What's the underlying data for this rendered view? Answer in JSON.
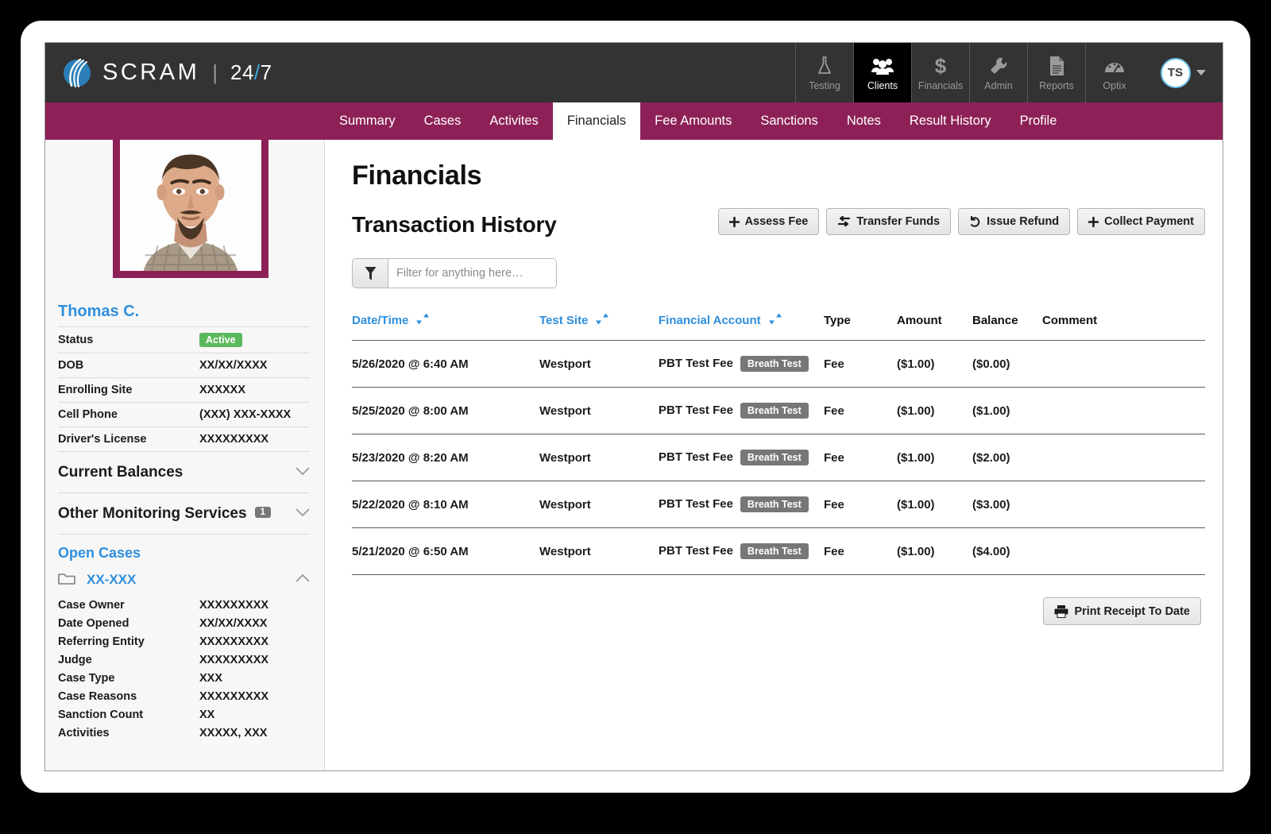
{
  "brand": {
    "name": "SCRAM",
    "separator": "|",
    "suffix_left": "24",
    "slash": "/",
    "suffix_right": "7",
    "logo_icon": "scram-wave-logo-icon"
  },
  "topnav": {
    "items": [
      {
        "label": "Testing",
        "icon": "flask-icon",
        "active": false
      },
      {
        "label": "Clients",
        "icon": "people-icon",
        "active": true
      },
      {
        "label": "Financials",
        "icon": "dollar-sign-icon",
        "active": false
      },
      {
        "label": "Admin",
        "icon": "wrench-icon",
        "active": false
      },
      {
        "label": "Reports",
        "icon": "document-icon",
        "active": false
      },
      {
        "label": "Optix",
        "icon": "gauge-icon",
        "active": false
      }
    ],
    "avatar_initials": "TS",
    "avatar_caret_icon": "caret-down-icon"
  },
  "tabs": [
    {
      "label": "Summary",
      "active": false
    },
    {
      "label": "Cases",
      "active": false
    },
    {
      "label": "Activites",
      "active": false
    },
    {
      "label": "Financials",
      "active": true
    },
    {
      "label": "Fee Amounts",
      "active": false
    },
    {
      "label": "Sanctions",
      "active": false
    },
    {
      "label": "Notes",
      "active": false
    },
    {
      "label": "Result History",
      "active": false
    },
    {
      "label": "Profile",
      "active": false
    }
  ],
  "sidebar": {
    "photo_alt": "client-photo",
    "client_name": "Thomas C.",
    "details": [
      {
        "key": "Status",
        "value": "Active",
        "is_badge": true
      },
      {
        "key": "DOB",
        "value": "XX/XX/XXXX",
        "is_badge": false
      },
      {
        "key": "Enrolling Site",
        "value": "XXXXXX",
        "is_badge": false
      },
      {
        "key": "Cell Phone",
        "value": "(XXX) XXX-XXXX",
        "is_badge": false
      },
      {
        "key": "Driver's License",
        "value": "XXXXXXXXX",
        "is_badge": false
      }
    ],
    "accordions": [
      {
        "title": "Current Balances",
        "count": null,
        "chevron": "chevron-down-icon"
      },
      {
        "title": "Other Monitoring Services",
        "count": "1",
        "chevron": "chevron-down-icon"
      }
    ],
    "open_cases_title": "Open Cases",
    "case": {
      "folder_icon": "folder-icon",
      "id": "XX-XXX",
      "chevron": "chevron-up-icon",
      "fields": [
        {
          "key": "Case Owner",
          "value": "XXXXXXXXX"
        },
        {
          "key": "Date Opened",
          "value": "XX/XX/XXXX"
        },
        {
          "key": "Referring Entity",
          "value": "XXXXXXXXX"
        },
        {
          "key": "Judge",
          "value": "XXXXXXXXX"
        },
        {
          "key": "Case Type",
          "value": "XXX"
        },
        {
          "key": "Case Reasons",
          "value": "XXXXXXXXX"
        },
        {
          "key": "Sanction Count",
          "value": "XX"
        },
        {
          "key": "Activities",
          "value": "XXXXX, XXX"
        }
      ]
    }
  },
  "main": {
    "page_title": "Financials",
    "section_title": "Transaction History",
    "actions": [
      {
        "label": "Assess Fee",
        "icon": "plus-icon"
      },
      {
        "label": "Transfer Funds",
        "icon": "transfer-arrows-icon"
      },
      {
        "label": "Issue Refund",
        "icon": "undo-arrow-icon"
      },
      {
        "label": "Collect Payment",
        "icon": "plus-icon"
      }
    ],
    "filter": {
      "icon": "funnel-icon",
      "placeholder": "Filter for anything here…",
      "value": ""
    },
    "table": {
      "columns": [
        {
          "label": "Date/Time",
          "sortable": true,
          "sort_icon": "sort-arrows-icon"
        },
        {
          "label": "Test Site",
          "sortable": true,
          "sort_icon": "sort-arrows-icon"
        },
        {
          "label": "Financial Account",
          "sortable": true,
          "sort_icon": "sort-arrows-icon"
        },
        {
          "label": "Type",
          "sortable": false,
          "sort_icon": null
        },
        {
          "label": "Amount",
          "sortable": false,
          "sort_icon": null
        },
        {
          "label": "Balance",
          "sortable": false,
          "sort_icon": null
        },
        {
          "label": "Comment",
          "sortable": false,
          "sort_icon": null
        }
      ],
      "rows": [
        {
          "datetime": "5/26/2020 @ 6:40 AM",
          "test_site": "Westport",
          "account": "PBT Test Fee",
          "account_badge": "Breath Test",
          "type": "Fee",
          "amount": "($1.00)",
          "balance": "($0.00)",
          "comment": ""
        },
        {
          "datetime": "5/25/2020 @ 8:00 AM",
          "test_site": "Westport",
          "account": "PBT Test Fee",
          "account_badge": "Breath Test",
          "type": "Fee",
          "amount": "($1.00)",
          "balance": "($1.00)",
          "comment": ""
        },
        {
          "datetime": "5/23/2020 @ 8:20 AM",
          "test_site": "Westport",
          "account": "PBT Test Fee",
          "account_badge": "Breath Test",
          "type": "Fee",
          "amount": "($1.00)",
          "balance": "($2.00)",
          "comment": ""
        },
        {
          "datetime": "5/22/2020 @ 8:10 AM",
          "test_site": "Westport",
          "account": "PBT Test Fee",
          "account_badge": "Breath Test",
          "type": "Fee",
          "amount": "($1.00)",
          "balance": "($3.00)",
          "comment": ""
        },
        {
          "datetime": "5/21/2020 @ 6:50 AM",
          "test_site": "Westport",
          "account": "PBT Test Fee",
          "account_badge": "Breath Test",
          "type": "Fee",
          "amount": "($1.00)",
          "balance": "($4.00)",
          "comment": ""
        }
      ]
    },
    "print_button": {
      "label": "Print Receipt To Date",
      "icon": "printer-icon"
    }
  },
  "colors": {
    "brand_magenta": "#8d2157",
    "topbar_dark": "#333334",
    "link_blue": "#2f8fdd",
    "negative_red": "#e02020",
    "badge_green": "#5cb85c",
    "badge_gray": "#777777",
    "logo_blue": "#2c7fb8"
  }
}
